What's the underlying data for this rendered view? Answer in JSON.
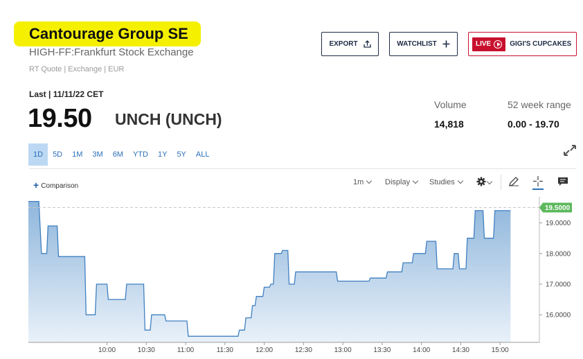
{
  "header": {
    "title": "Cantourage Group SE",
    "exchange": "HIGH-FF:Frankfurt Stock Exchange",
    "meta": "RT Quote | Exchange | EUR"
  },
  "buttons": {
    "export": "EXPORT",
    "watchlist": "WATCHLIST",
    "live_badge": "LIVE",
    "live_show": "GIGI'S CUPCAKES"
  },
  "quote": {
    "last_label": "Last | 11/11/22 CET",
    "price": "19.50",
    "change": "UNCH (UNCH)"
  },
  "stats": {
    "volume_label": "Volume",
    "volume_value": "14,818",
    "range_label": "52 week range",
    "range_value": "0.00 - 19.70"
  },
  "range_tabs": [
    {
      "label": "1D",
      "active": true
    },
    {
      "label": "5D"
    },
    {
      "label": "1M"
    },
    {
      "label": "3M"
    },
    {
      "label": "6M"
    },
    {
      "label": "YTD"
    },
    {
      "label": "1Y"
    },
    {
      "label": "5Y"
    },
    {
      "label": "ALL"
    }
  ],
  "toolbar": {
    "comparison": "Comparison",
    "interval": "1m",
    "display": "Display",
    "studies": "Studies"
  },
  "colors": {
    "line": "#3f7fc0",
    "fill_top": "#8fb6dc",
    "fill_bottom": "#e9f1f9",
    "last_price_badge": "#5cb85c",
    "accent": "#1c2a44",
    "live": "#c8102e",
    "highlight": "#f4f000"
  },
  "chart_data": {
    "type": "area",
    "y_ticks": [
      "16.0000",
      "17.0000",
      "18.0000",
      "19.0000"
    ],
    "x_ticks": [
      "10:00",
      "10:30",
      "11:00",
      "11:30",
      "12:00",
      "12:30",
      "13:00",
      "13:30",
      "14:00",
      "14:30",
      "15:00"
    ],
    "last_price_label": "19.5000",
    "last_price": 19.5,
    "ylim": [
      15.1,
      19.85
    ],
    "xlim": [
      "09:00",
      "15:30"
    ],
    "series": [
      {
        "x": [
          "09:00",
          "09:08",
          "09:10",
          "09:14",
          "09:15",
          "09:22",
          "09:23",
          "09:30",
          "09:31",
          "09:43",
          "09:44",
          "09:46",
          "09:47",
          "09:51",
          "09:52",
          "10:00",
          "10:01",
          "10:08",
          "10:09",
          "10:14",
          "10:15",
          "10:23",
          "10:24",
          "10:28",
          "10:29",
          "10:33",
          "10:34",
          "10:44",
          "10:45",
          "10:58",
          "10:59",
          "11:01",
          "11:02",
          "11:21",
          "11:22",
          "11:26",
          "11:27",
          "11:37",
          "11:38",
          "11:40",
          "11:41",
          "11:43",
          "11:44",
          "11:45",
          "11:46",
          "11:50",
          "11:51",
          "11:53",
          "11:54",
          "11:59",
          "12:00",
          "12:04",
          "12:05",
          "12:07",
          "12:08",
          "12:10",
          "12:11",
          "12:13",
          "12:14",
          "12:18",
          "12:19",
          "12:23",
          "12:24",
          "12:41",
          "12:42",
          "12:55",
          "12:56",
          "13:04",
          "13:05",
          "13:08",
          "13:09",
          "13:20",
          "13:21",
          "13:24",
          "13:25",
          "13:33",
          "13:34",
          "13:45",
          "13:46",
          "13:53",
          "13:54",
          "14:03",
          "14:04",
          "14:11",
          "14:12",
          "14:15",
          "14:16",
          "14:24",
          "14:25",
          "14:28",
          "14:29",
          "14:34",
          "14:35",
          "14:40",
          "14:41",
          "14:47",
          "14:48",
          "14:55",
          "14:56",
          "15:08"
        ],
        "values": [
          19.7,
          19.7,
          18.0,
          18.0,
          18.9,
          18.9,
          17.9,
          17.9,
          17.9,
          17.9,
          16.0,
          16.0,
          16.0,
          16.0,
          17.0,
          17.0,
          16.5,
          16.5,
          16.5,
          16.5,
          17.0,
          17.0,
          17.0,
          17.0,
          15.5,
          15.5,
          16.0,
          16.0,
          15.8,
          15.8,
          15.8,
          15.8,
          15.3,
          15.3,
          15.3,
          15.3,
          15.3,
          15.3,
          15.3,
          15.3,
          15.5,
          15.5,
          15.5,
          15.5,
          15.9,
          15.9,
          16.3,
          16.3,
          16.6,
          16.6,
          16.9,
          16.9,
          17.0,
          17.0,
          18.0,
          18.0,
          18.0,
          18.0,
          18.1,
          18.1,
          17.0,
          17.0,
          17.4,
          17.4,
          17.4,
          17.4,
          17.1,
          17.1,
          17.1,
          17.1,
          17.1,
          17.1,
          17.2,
          17.2,
          17.2,
          17.2,
          17.4,
          17.4,
          17.7,
          17.7,
          18.0,
          18.0,
          18.4,
          18.4,
          17.5,
          17.5,
          17.5,
          17.5,
          18.0,
          18.0,
          17.5,
          17.5,
          18.5,
          18.5,
          19.4,
          19.4,
          18.5,
          18.5,
          19.4,
          19.4
        ]
      }
    ]
  }
}
